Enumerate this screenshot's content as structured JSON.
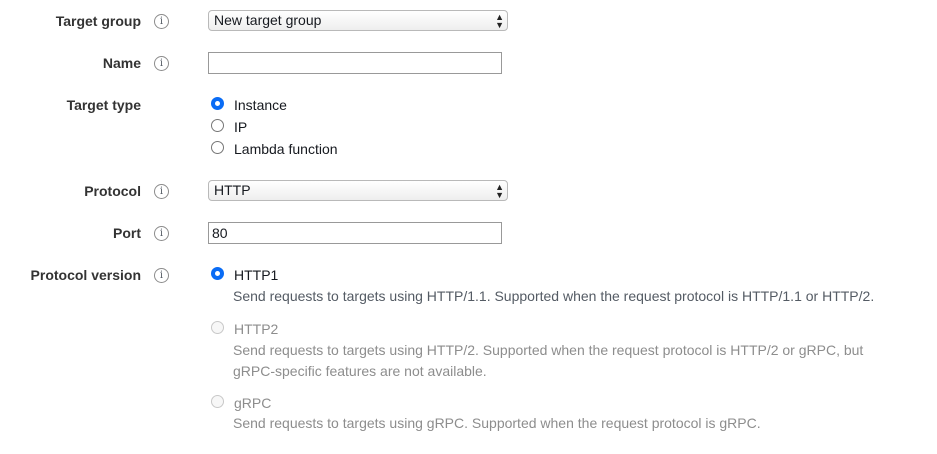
{
  "target_group": {
    "label": "Target group",
    "selected": "New target group"
  },
  "name": {
    "label": "Name",
    "value": ""
  },
  "target_type": {
    "label": "Target type",
    "options": [
      "Instance",
      "IP",
      "Lambda function"
    ],
    "selected": "Instance"
  },
  "protocol": {
    "label": "Protocol",
    "selected": "HTTP"
  },
  "port": {
    "label": "Port",
    "value": "80"
  },
  "protocol_version": {
    "label": "Protocol version",
    "selected": "HTTP1",
    "options": [
      {
        "label": "HTTP1",
        "description": "Send requests to targets using HTTP/1.1. Supported when the request protocol is HTTP/1.1 or HTTP/2.",
        "enabled": true
      },
      {
        "label": "HTTP2",
        "description": "Send requests to targets using HTTP/2. Supported when the request protocol is HTTP/2 or gRPC, but gRPC-specific features are not available.",
        "enabled": false
      },
      {
        "label": "gRPC",
        "description": "Send requests to targets using gRPC. Supported when the request protocol is gRPC.",
        "enabled": false
      }
    ]
  },
  "info_icon_glyph": "i",
  "colors": {
    "radio_selected": "#0a6cf5",
    "label_text": "#333333",
    "disabled_text": "#8d8d8d"
  }
}
